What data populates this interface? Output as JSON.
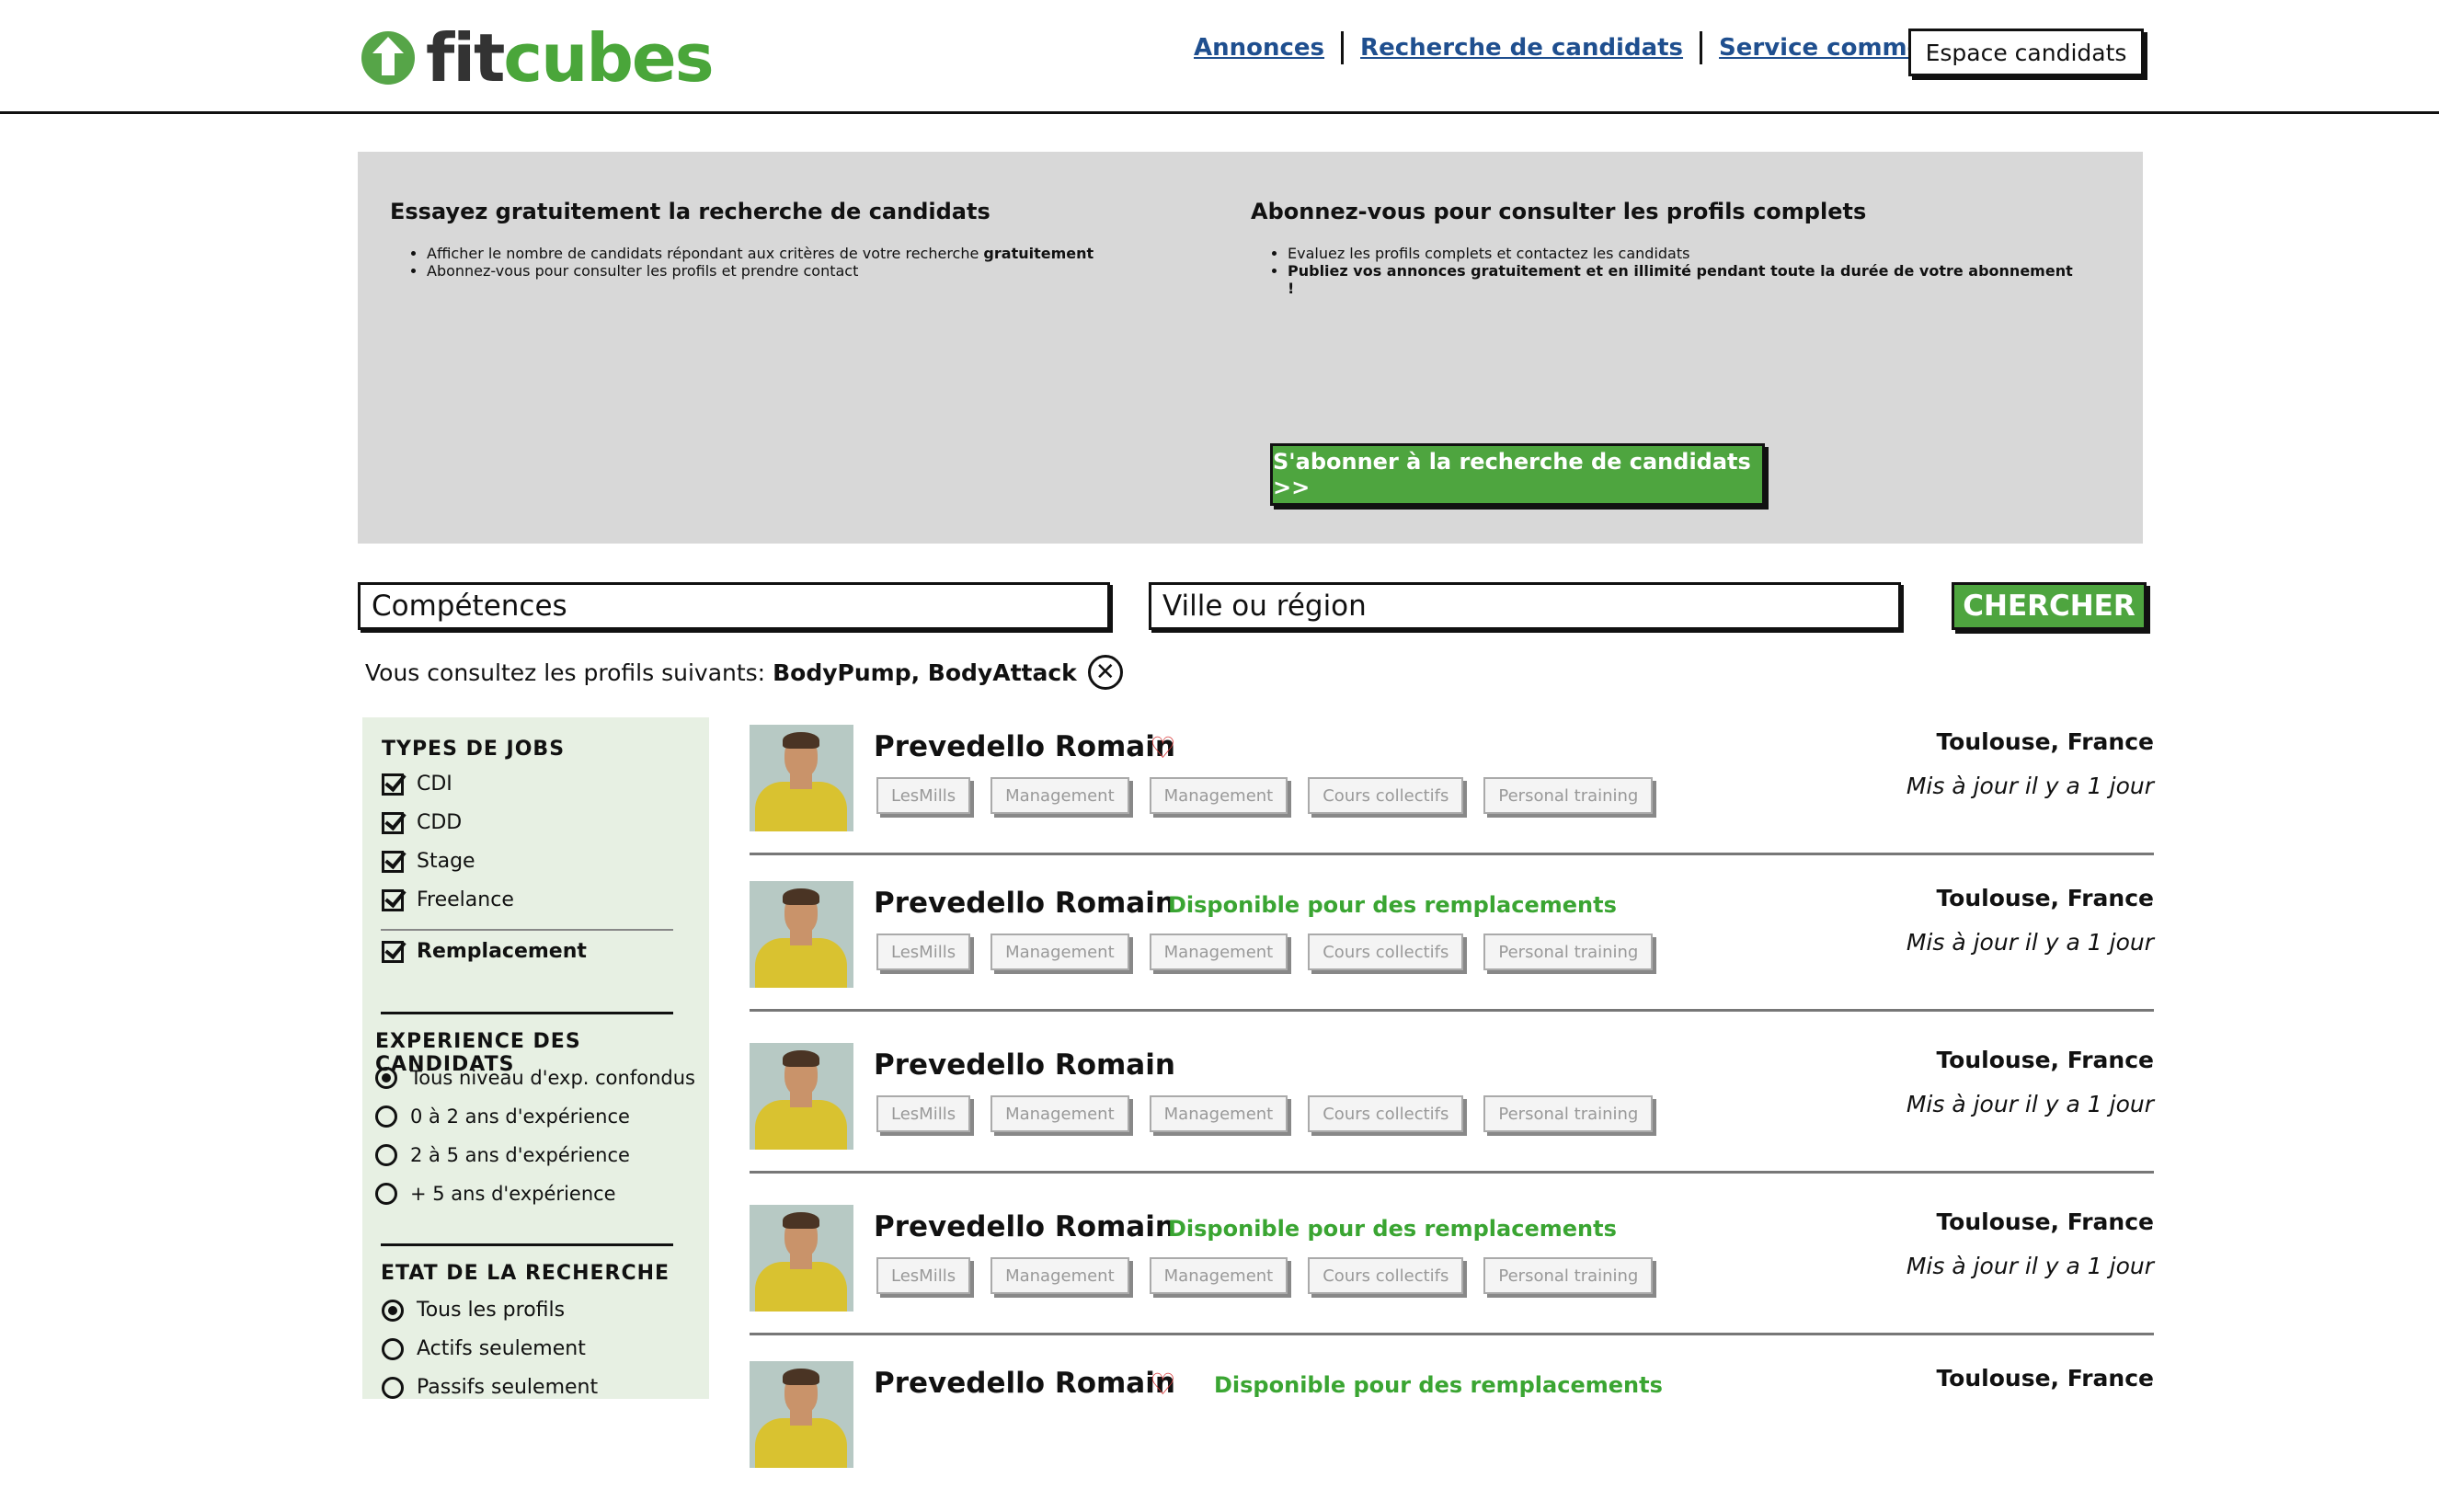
{
  "header": {
    "logo_fit": "fit",
    "logo_cubes": "cubes",
    "nav": [
      "Annonces",
      "Recherche de candidats",
      "Service commercial"
    ],
    "espace_candidats": "Espace candidats"
  },
  "promo": {
    "left_title": "Essayez gratuitement la recherche de candidats",
    "left_bullet1_text": "Afficher le nombre de candidats répondant aux critères de votre recherche",
    "left_bullet1_bold": "gratuitement",
    "left_bullet2_link": "Abonnez-vous",
    "left_bullet2_text": "pour consulter les profils et prendre contact",
    "right_title": "Abonnez-vous pour consulter les profils complets",
    "right_bullet1": "Evaluez les profils complets et contactez les candidats",
    "right_bullet2": "Publiez vos annonces gratuitement et en illimité pendant toute la durée de votre abonnement !",
    "cta": "S'abonner à la recherche de candidats >>"
  },
  "search": {
    "competences_placeholder": "Compétences",
    "ville_placeholder": "Ville ou région",
    "button": "CHERCHER",
    "consult_label": "Vous consultez les profils suivants:",
    "consult_values": "BodyPump, BodyAttack",
    "clear_glyph": "✕"
  },
  "sidebar": {
    "types_title": "TYPES DE JOBS",
    "types": [
      "CDI",
      "CDD",
      "Stage",
      "Freelance"
    ],
    "remplacement": "Remplacement",
    "exp_title": "EXPERIENCE DES CANDIDATS",
    "exp_options": [
      "Tous niveau d'exp. confondus",
      "0 à 2 ans d'expérience",
      "2 à 5 ans d'expérience",
      "+ 5 ans d'expérience"
    ],
    "etat_title": "ETAT DE LA RECHERCHE",
    "etat_options": [
      "Tous les profils",
      "Actifs seulement",
      "Passifs seulement"
    ]
  },
  "results": [
    {
      "name": "Prevedello Romain",
      "favorite": true,
      "dispo": "",
      "tags": [
        "LesMills",
        "Management",
        "Management",
        "Cours collectifs",
        "Personal training"
      ],
      "city": "Toulouse, France",
      "updated": "Mis à jour il y a 1 jour"
    },
    {
      "name": "Prevedello Romain",
      "favorite": false,
      "dispo": "Disponible pour des remplacements",
      "tags": [
        "LesMills",
        "Management",
        "Management",
        "Cours collectifs",
        "Personal training"
      ],
      "city": "Toulouse, France",
      "updated": "Mis à jour il y a 1 jour"
    },
    {
      "name": "Prevedello Romain",
      "favorite": false,
      "dispo": "",
      "tags": [
        "LesMills",
        "Management",
        "Management",
        "Cours collectifs",
        "Personal training"
      ],
      "city": "Toulouse, France",
      "updated": "Mis à jour il y a 1 jour"
    },
    {
      "name": "Prevedello Romain",
      "favorite": false,
      "dispo": "Disponible pour des remplacements",
      "tags": [
        "LesMills",
        "Management",
        "Management",
        "Cours collectifs",
        "Personal training"
      ],
      "city": "Toulouse, France",
      "updated": "Mis à jour il y a 1 jour"
    },
    {
      "name": "Prevedello Romain",
      "favorite": true,
      "dispo": "Disponible pour des remplacements",
      "tags": [],
      "city": "Toulouse, France",
      "updated": ""
    }
  ],
  "colors": {
    "brand_green": "#4ea53f",
    "link_blue": "#1f4f8f",
    "dispo_green": "#3aa532",
    "heart_red": "#d83a3a"
  }
}
